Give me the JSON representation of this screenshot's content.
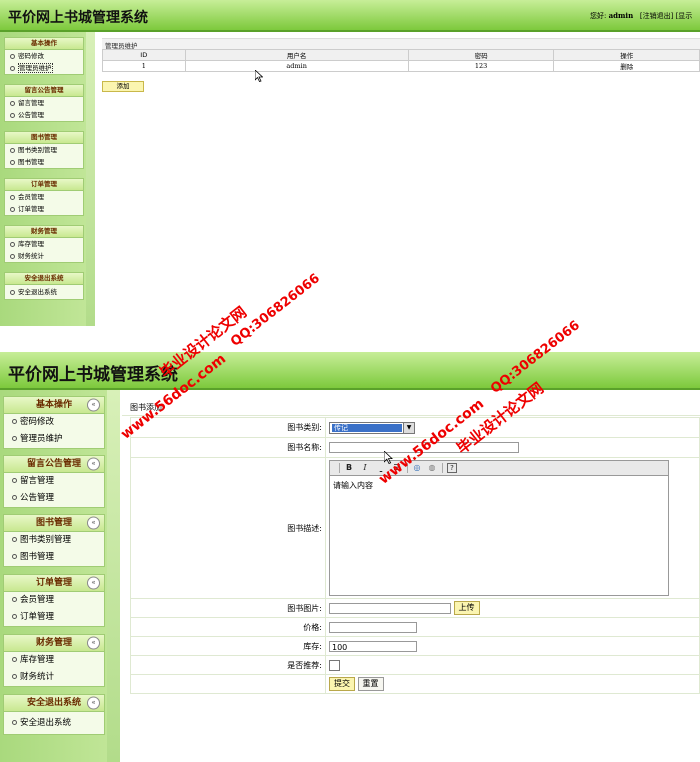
{
  "app": {
    "title": "平价网上书城管理系统",
    "greeting_prefix": "您好:",
    "user": "admin",
    "logout": "[注销退出]",
    "home": "[显示"
  },
  "menu": [
    {
      "title": "基本操作",
      "items": [
        "密码修改",
        "管理员维护"
      ]
    },
    {
      "title": "留言公告管理",
      "items": [
        "留言管理",
        "公告管理"
      ]
    },
    {
      "title": "图书管理",
      "items": [
        "图书类别管理",
        "图书管理"
      ]
    },
    {
      "title": "订单管理",
      "items": [
        "会员管理",
        "订单管理"
      ]
    },
    {
      "title": "财务管理",
      "items": [
        "库存管理",
        "财务统计"
      ]
    },
    {
      "title": "安全退出系统",
      "items": [
        "安全退出系统"
      ]
    }
  ],
  "chevron": "«",
  "admin_panel": {
    "title": "管理员维护",
    "columns": [
      "ID",
      "用户名",
      "密码",
      "操作"
    ],
    "rows": [
      [
        "1",
        "admin",
        "123",
        "删除"
      ]
    ],
    "add_button": "添加"
  },
  "book_form": {
    "title": "图书添加",
    "category_label": "图书类别:",
    "category_value": "传记",
    "name_label": "图书名称:",
    "desc_label": "图书描述:",
    "desc_placeholder": "请输入内容",
    "image_label": "图书图片:",
    "upload_button": "上传",
    "price_label": "价格:",
    "stock_label": "库存:",
    "stock_value": "100",
    "recommend_label": "是否推荐:",
    "submit_button": "提交",
    "reset_button": "重置"
  },
  "editor_toolbar": {
    "bold": "B",
    "italic": "I",
    "list": "☰",
    "link": "◎",
    "image": "◍",
    "help": "?"
  },
  "watermarks": {
    "site": "www.56doc.com",
    "name": "毕业设计论文网",
    "qq": "QQ:306826066"
  }
}
